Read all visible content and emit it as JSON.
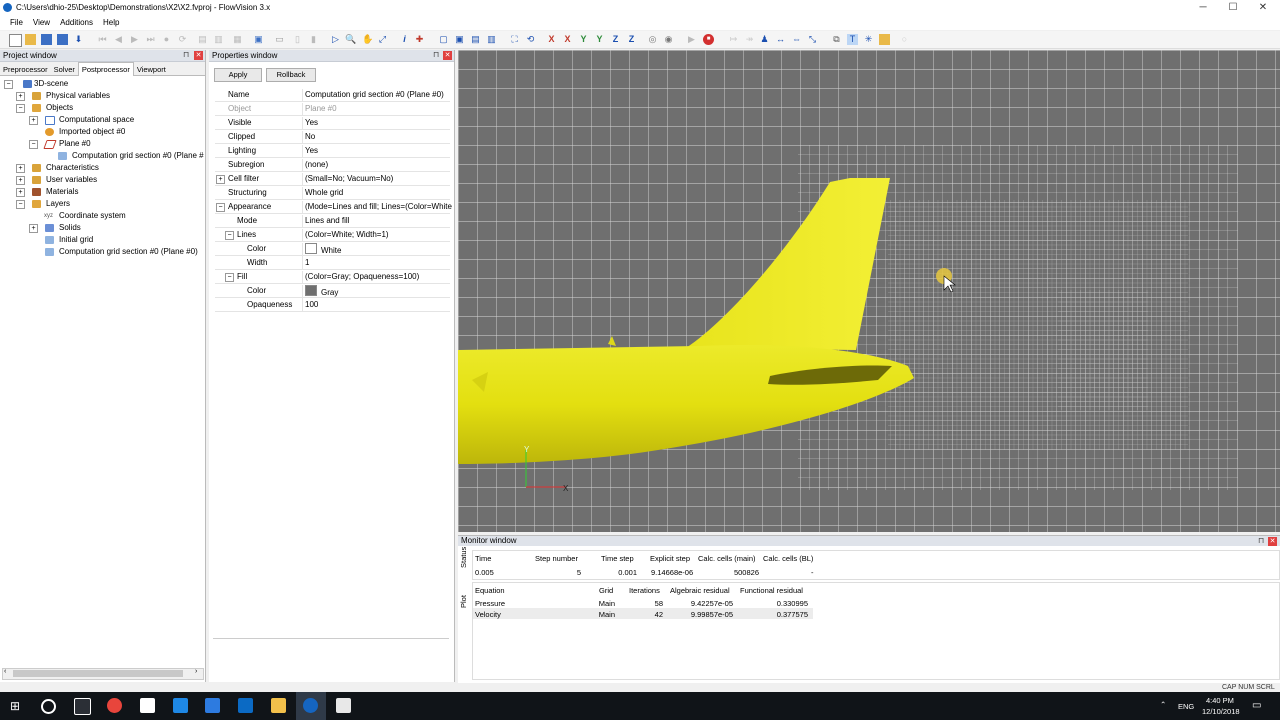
{
  "window": {
    "title": "C:\\Users\\dhio-25\\Desktop\\Demonstrations\\X2\\X2.fvproj - FlowVision 3.x",
    "controls": {
      "minimize": "─",
      "maximize": "☐",
      "close": "✕"
    }
  },
  "menu": [
    "File",
    "View",
    "Additions",
    "Help"
  ],
  "project_window": {
    "title": "Project window",
    "tabs": [
      "Preprocessor",
      "Solver",
      "Postprocessor",
      "Viewport"
    ],
    "active_tab": "Postprocessor",
    "tree": [
      "3D-scene",
      "Physical variables",
      "Objects",
      "Computational space",
      "Imported object #0",
      "Plane #0",
      "Computation grid section #0 (Plane #",
      "Characteristics",
      "User variables",
      "Materials",
      "Layers",
      "Coordinate system",
      "Solids",
      "Initial grid",
      "Computation grid section #0 (Plane #0)"
    ]
  },
  "properties_window": {
    "title": "Properties window",
    "apply": "Apply",
    "rollback": "Rollback",
    "rows": [
      {
        "name": "Name",
        "value": "Computation grid section #0 (Plane #0)"
      },
      {
        "name": "Object",
        "value": "Plane #0"
      },
      {
        "name": "Visible",
        "value": "Yes"
      },
      {
        "name": "Clipped",
        "value": "No"
      },
      {
        "name": "Lighting",
        "value": "Yes"
      },
      {
        "name": "Subregion",
        "value": "(none)"
      },
      {
        "name": "Cell filter",
        "value": "(Small=No; Vacuum=No)"
      },
      {
        "name": "Structuring",
        "value": "Whole grid"
      },
      {
        "name": "Appearance",
        "value": "(Mode=Lines and fill; Lines=(Color=White"
      },
      {
        "name": "Mode",
        "value": "Lines and fill"
      },
      {
        "name": "Lines",
        "value": "(Color=White; Width=1)"
      },
      {
        "name": "Color",
        "value": "White"
      },
      {
        "name": "Width",
        "value": "1"
      },
      {
        "name": "Fill",
        "value": "(Color=Gray; Opaqueness=100)"
      },
      {
        "name": "Color",
        "value": "Gray"
      },
      {
        "name": "Opaqueness",
        "value": "100"
      }
    ]
  },
  "viewport": {
    "axis_y": "Y",
    "axis_x": "X",
    "model_color": "#f2ee1a",
    "background_color": "#6f6f6f"
  },
  "monitor": {
    "title": "Monitor window",
    "status_tab": "Status",
    "plot_tab": "Plot",
    "status_headers": [
      "Time",
      "Step number",
      "Time step",
      "Explicit step",
      "Calc. cells (main)",
      "Calc. cells (BL)"
    ],
    "status_values": [
      "0.005",
      "5",
      "0.001",
      "9.14668e-06",
      "500826",
      "-"
    ],
    "eq_headers": [
      "Equation",
      "Grid",
      "Iterations",
      "Algebraic residual",
      "Functional residual"
    ],
    "eq_rows": [
      [
        "Pressure",
        "Main",
        "58",
        "9.42257e-05",
        "0.330995"
      ],
      [
        "Velocity",
        "Main",
        "42",
        "9.99857e-05",
        "0.377575"
      ]
    ]
  },
  "taskbar": {
    "lang": "ENG",
    "time": "4:40 PM",
    "date": "12/10/2018",
    "keys": "CAP  NUM  SCRL"
  }
}
